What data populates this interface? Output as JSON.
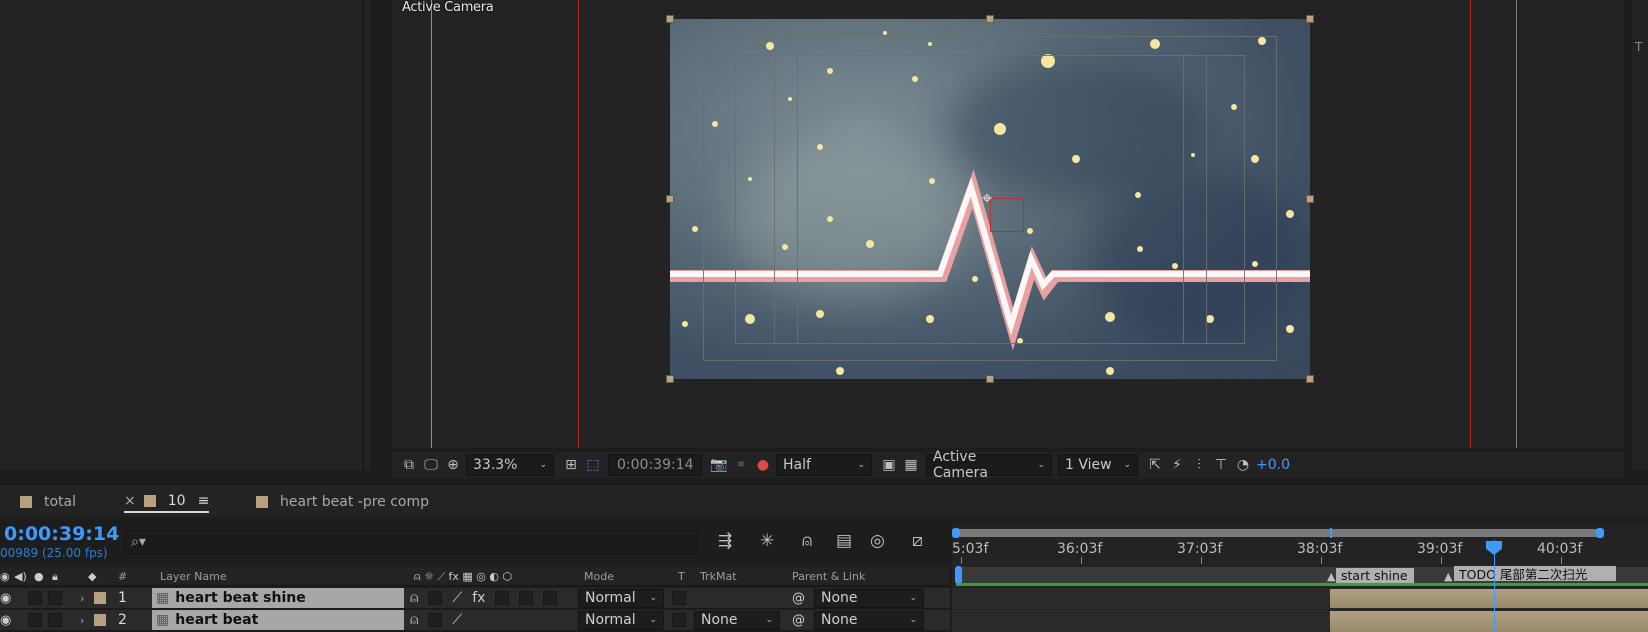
{
  "viewer": {
    "label": "Active Camera",
    "zoom": "33.3%",
    "timecode": "0:00:39:14",
    "resolution": "Half",
    "camera": "Active Camera",
    "views": "1 View",
    "exposure": "+0.0"
  },
  "tabs": [
    {
      "label": "total"
    },
    {
      "label": "10",
      "close": "×",
      "menu": "≡"
    },
    {
      "label": "heart beat -pre comp"
    }
  ],
  "timeline": {
    "timecode": "0:00:39:14",
    "frames": "00989 (25.00 fps)",
    "search_placeholder": "⌕▾",
    "ruler": [
      "5:03f",
      "36:03f",
      "37:03f",
      "38:03f",
      "39:03f",
      "40:03f"
    ],
    "columns": {
      "number": "#",
      "layer_name": "Layer Name",
      "mode": "Mode",
      "t": "T",
      "trkmat": "TrkMat",
      "parent": "Parent & Link"
    },
    "layers": [
      {
        "index": "1",
        "name": "heart beat shine",
        "mode": "Normal",
        "trkmat": "",
        "parent": "None"
      },
      {
        "index": "2",
        "name": "heart beat",
        "mode": "Normal",
        "trkmat": "None",
        "parent": "None"
      }
    ],
    "markers": [
      {
        "label": "start shine"
      },
      {
        "label": "TODO 尾部第二次扫光"
      }
    ]
  },
  "colors": {
    "accent": "#3f9aff",
    "label_swatch": "#b8a181",
    "guide_red": "#b52a2a",
    "layer_bar": "#9f8e72",
    "work_area": "#34a33a"
  }
}
